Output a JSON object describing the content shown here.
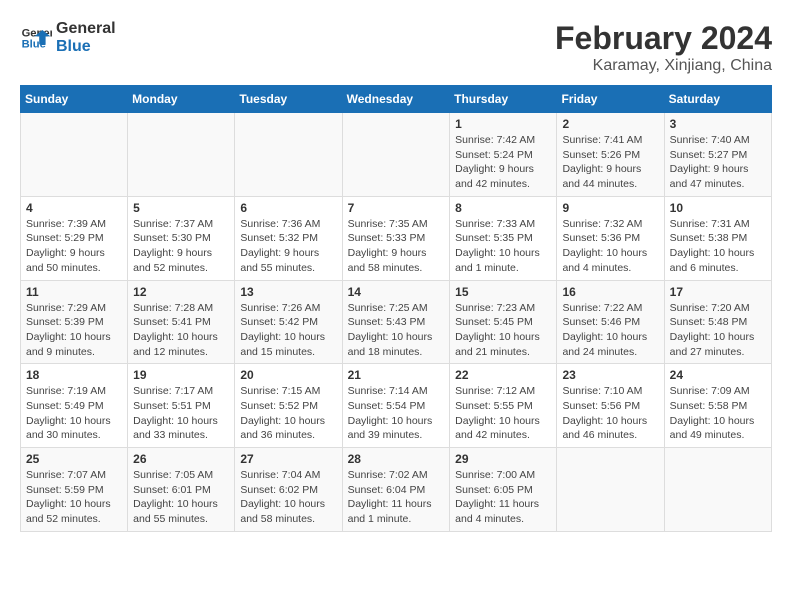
{
  "logo": {
    "line1": "General",
    "line2": "Blue"
  },
  "title": "February 2024",
  "subtitle": "Karamay, Xinjiang, China",
  "days_of_week": [
    "Sunday",
    "Monday",
    "Tuesday",
    "Wednesday",
    "Thursday",
    "Friday",
    "Saturday"
  ],
  "weeks": [
    [
      {
        "day": "",
        "info": ""
      },
      {
        "day": "",
        "info": ""
      },
      {
        "day": "",
        "info": ""
      },
      {
        "day": "",
        "info": ""
      },
      {
        "day": "1",
        "info": "Sunrise: 7:42 AM\nSunset: 5:24 PM\nDaylight: 9 hours and 42 minutes."
      },
      {
        "day": "2",
        "info": "Sunrise: 7:41 AM\nSunset: 5:26 PM\nDaylight: 9 hours and 44 minutes."
      },
      {
        "day": "3",
        "info": "Sunrise: 7:40 AM\nSunset: 5:27 PM\nDaylight: 9 hours and 47 minutes."
      }
    ],
    [
      {
        "day": "4",
        "info": "Sunrise: 7:39 AM\nSunset: 5:29 PM\nDaylight: 9 hours and 50 minutes."
      },
      {
        "day": "5",
        "info": "Sunrise: 7:37 AM\nSunset: 5:30 PM\nDaylight: 9 hours and 52 minutes."
      },
      {
        "day": "6",
        "info": "Sunrise: 7:36 AM\nSunset: 5:32 PM\nDaylight: 9 hours and 55 minutes."
      },
      {
        "day": "7",
        "info": "Sunrise: 7:35 AM\nSunset: 5:33 PM\nDaylight: 9 hours and 58 minutes."
      },
      {
        "day": "8",
        "info": "Sunrise: 7:33 AM\nSunset: 5:35 PM\nDaylight: 10 hours and 1 minute."
      },
      {
        "day": "9",
        "info": "Sunrise: 7:32 AM\nSunset: 5:36 PM\nDaylight: 10 hours and 4 minutes."
      },
      {
        "day": "10",
        "info": "Sunrise: 7:31 AM\nSunset: 5:38 PM\nDaylight: 10 hours and 6 minutes."
      }
    ],
    [
      {
        "day": "11",
        "info": "Sunrise: 7:29 AM\nSunset: 5:39 PM\nDaylight: 10 hours and 9 minutes."
      },
      {
        "day": "12",
        "info": "Sunrise: 7:28 AM\nSunset: 5:41 PM\nDaylight: 10 hours and 12 minutes."
      },
      {
        "day": "13",
        "info": "Sunrise: 7:26 AM\nSunset: 5:42 PM\nDaylight: 10 hours and 15 minutes."
      },
      {
        "day": "14",
        "info": "Sunrise: 7:25 AM\nSunset: 5:43 PM\nDaylight: 10 hours and 18 minutes."
      },
      {
        "day": "15",
        "info": "Sunrise: 7:23 AM\nSunset: 5:45 PM\nDaylight: 10 hours and 21 minutes."
      },
      {
        "day": "16",
        "info": "Sunrise: 7:22 AM\nSunset: 5:46 PM\nDaylight: 10 hours and 24 minutes."
      },
      {
        "day": "17",
        "info": "Sunrise: 7:20 AM\nSunset: 5:48 PM\nDaylight: 10 hours and 27 minutes."
      }
    ],
    [
      {
        "day": "18",
        "info": "Sunrise: 7:19 AM\nSunset: 5:49 PM\nDaylight: 10 hours and 30 minutes."
      },
      {
        "day": "19",
        "info": "Sunrise: 7:17 AM\nSunset: 5:51 PM\nDaylight: 10 hours and 33 minutes."
      },
      {
        "day": "20",
        "info": "Sunrise: 7:15 AM\nSunset: 5:52 PM\nDaylight: 10 hours and 36 minutes."
      },
      {
        "day": "21",
        "info": "Sunrise: 7:14 AM\nSunset: 5:54 PM\nDaylight: 10 hours and 39 minutes."
      },
      {
        "day": "22",
        "info": "Sunrise: 7:12 AM\nSunset: 5:55 PM\nDaylight: 10 hours and 42 minutes."
      },
      {
        "day": "23",
        "info": "Sunrise: 7:10 AM\nSunset: 5:56 PM\nDaylight: 10 hours and 46 minutes."
      },
      {
        "day": "24",
        "info": "Sunrise: 7:09 AM\nSunset: 5:58 PM\nDaylight: 10 hours and 49 minutes."
      }
    ],
    [
      {
        "day": "25",
        "info": "Sunrise: 7:07 AM\nSunset: 5:59 PM\nDaylight: 10 hours and 52 minutes."
      },
      {
        "day": "26",
        "info": "Sunrise: 7:05 AM\nSunset: 6:01 PM\nDaylight: 10 hours and 55 minutes."
      },
      {
        "day": "27",
        "info": "Sunrise: 7:04 AM\nSunset: 6:02 PM\nDaylight: 10 hours and 58 minutes."
      },
      {
        "day": "28",
        "info": "Sunrise: 7:02 AM\nSunset: 6:04 PM\nDaylight: 11 hours and 1 minute."
      },
      {
        "day": "29",
        "info": "Sunrise: 7:00 AM\nSunset: 6:05 PM\nDaylight: 11 hours and 4 minutes."
      },
      {
        "day": "",
        "info": ""
      },
      {
        "day": "",
        "info": ""
      }
    ]
  ]
}
